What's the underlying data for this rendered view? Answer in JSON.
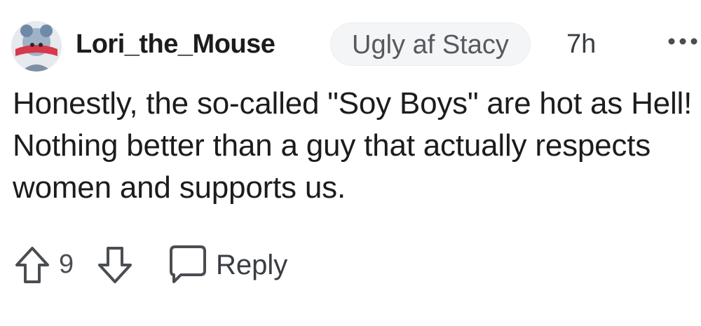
{
  "comment": {
    "username": "Lori_the_Mouse",
    "flair": "Ugly af Stacy",
    "timestamp": "7h",
    "body": "Honestly, the so-called \"Soy Boys\" are hot as Hell! Nothing better than a guy that actually respects women and supports us.",
    "vote_count": "9",
    "reply_label": "Reply"
  },
  "icons": {
    "avatar": "avatar-icon",
    "more": "more-options-icon",
    "upvote": "upvote-arrow-icon",
    "downvote": "downvote-arrow-icon",
    "reply": "speech-bubble-icon"
  },
  "colors": {
    "text": "#1c1c1c",
    "flair_bg": "#f4f5f6",
    "muted": "#4a4d52",
    "avatar_accent": "#d63a4a"
  }
}
